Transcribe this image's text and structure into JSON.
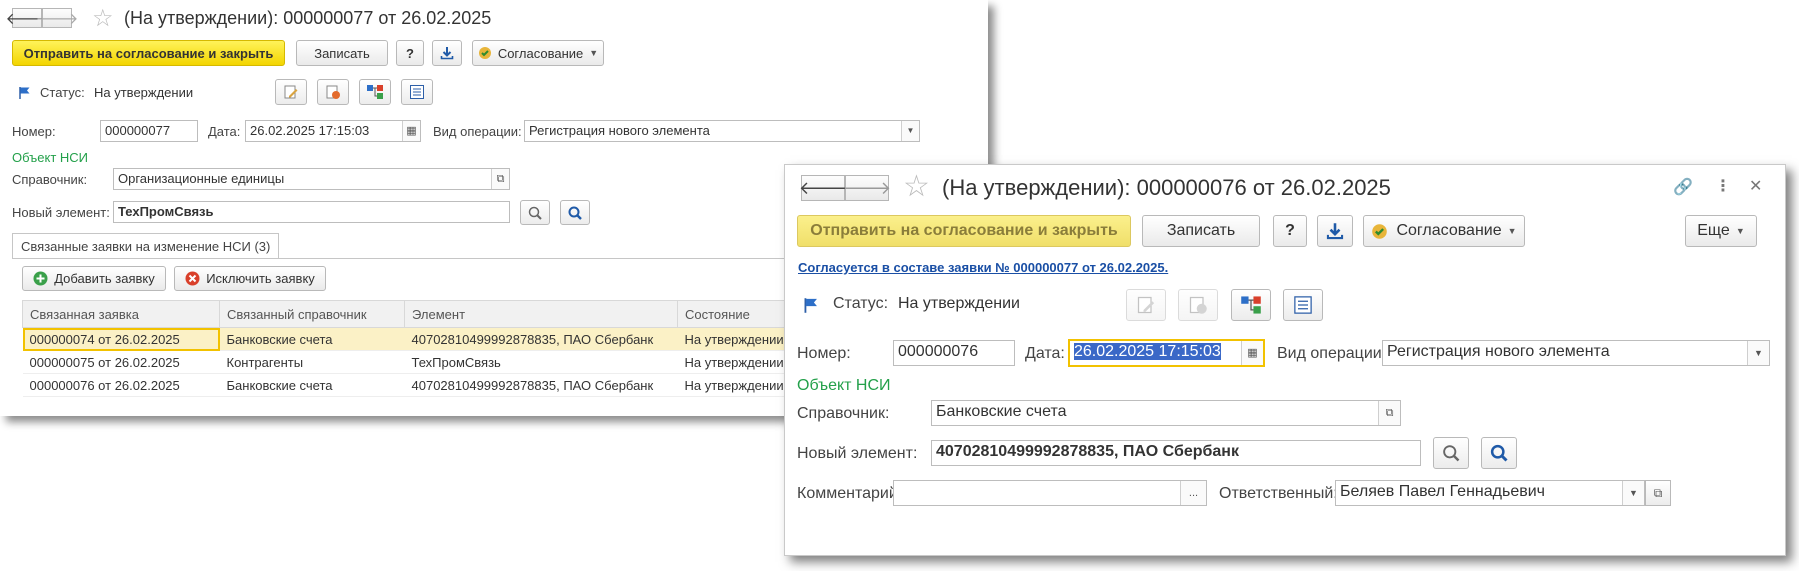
{
  "win1": {
    "title": "(На утверждении): 000000077 от 26.02.2025",
    "toolbar": {
      "send_label": "Отправить на согласование и закрыть",
      "save_label": "Записать",
      "help_label": "?",
      "approval_label": "Согласование"
    },
    "status": {
      "label": "Статус:",
      "value": "На утверждении"
    },
    "number": {
      "label": "Номер:",
      "value": "000000077"
    },
    "date": {
      "label": "Дата:",
      "value": "26.02.2025 17:15:03"
    },
    "operation": {
      "label": "Вид операции:",
      "value": "Регистрация нового элемента"
    },
    "nsi_object_label": "Объект НСИ",
    "directory": {
      "label": "Справочник:",
      "value": "Организационные единицы"
    },
    "new_element": {
      "label": "Новый элемент:",
      "value": "ТехПромСвязь"
    },
    "tab_label": "Связанные заявки на изменение НСИ (3)",
    "add_request_label": "Добавить заявку",
    "exclude_request_label": "Исключить заявку",
    "table": {
      "columns": [
        "Связанная заявка",
        "Связанный справочник",
        "Элемент",
        "Состояние"
      ],
      "rows": [
        [
          "000000074 от 26.02.2025",
          "Банковские счета",
          "40702810499992878835, ПАО Сбербанк",
          "На утверждении"
        ],
        [
          "000000075 от 26.02.2025",
          "Контрагенты",
          "ТехПромСвязь",
          "На утверждении"
        ],
        [
          "000000076 от 26.02.2025",
          "Банковские счета",
          "40702810499992878835, ПАО Сбербанк",
          "На утверждении"
        ]
      ]
    }
  },
  "win2": {
    "title": "(На утверждении): 000000076 от 26.02.2025",
    "toolbar": {
      "send_label": "Отправить на согласование и закрыть",
      "save_label": "Записать",
      "help_label": "?",
      "approval_label": "Согласование",
      "more_label": "Еще"
    },
    "agreement_link": "Согласуется в составе заявки № 000000077 от 26.02.2025.",
    "status": {
      "label": "Статус:",
      "value": "На утверждении"
    },
    "number": {
      "label": "Номер:",
      "value": "000000076"
    },
    "date": {
      "label": "Дата:",
      "value": "26.02.2025 17:15:03"
    },
    "operation": {
      "label": "Вид операции:",
      "value": "Регистрация нового элемента"
    },
    "nsi_object_label": "Объект НСИ",
    "directory": {
      "label": "Справочник:",
      "value": "Банковские счета"
    },
    "new_element": {
      "label": "Новый элемент:",
      "value": "40702810499992878835, ПАО Сбербанк"
    },
    "comment": {
      "label": "Комментарий:",
      "value": "",
      "button": "..."
    },
    "responsible": {
      "label": "Ответственный:",
      "value": "Беляев Павел Геннадьевич"
    }
  }
}
